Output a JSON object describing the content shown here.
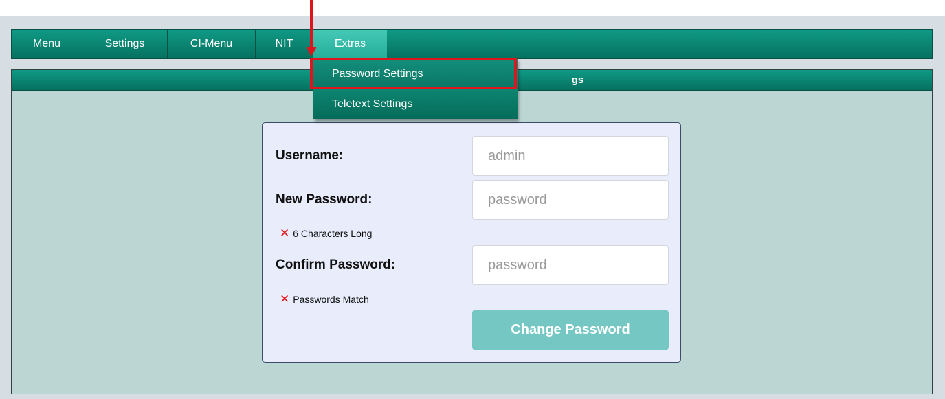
{
  "nav": {
    "items": [
      {
        "label": "Menu"
      },
      {
        "label": "Settings"
      },
      {
        "label": "CI-Menu"
      },
      {
        "label": "NIT"
      },
      {
        "label": "Extras"
      }
    ]
  },
  "panel": {
    "title_visible_fragment": "gs"
  },
  "dropdown": {
    "items": [
      {
        "label": "Password Settings"
      },
      {
        "label": "Teletext Settings"
      }
    ]
  },
  "form": {
    "username_label": "Username:",
    "username_placeholder": "admin",
    "new_password_label": "New Password:",
    "new_password_placeholder": "password",
    "rule_length": "6 Characters Long",
    "confirm_password_label": "Confirm Password:",
    "confirm_password_placeholder": "password",
    "rule_match": "Passwords Match",
    "submit_label": "Change Password",
    "fail_icon": "✕"
  },
  "colors": {
    "nav_green": "#06715f",
    "active_tab": "#26ad99",
    "panel_bg": "#bcd6d3",
    "card_bg": "#e8ecfb",
    "button": "#75c7c4",
    "annotation_red": "#e0141c"
  }
}
